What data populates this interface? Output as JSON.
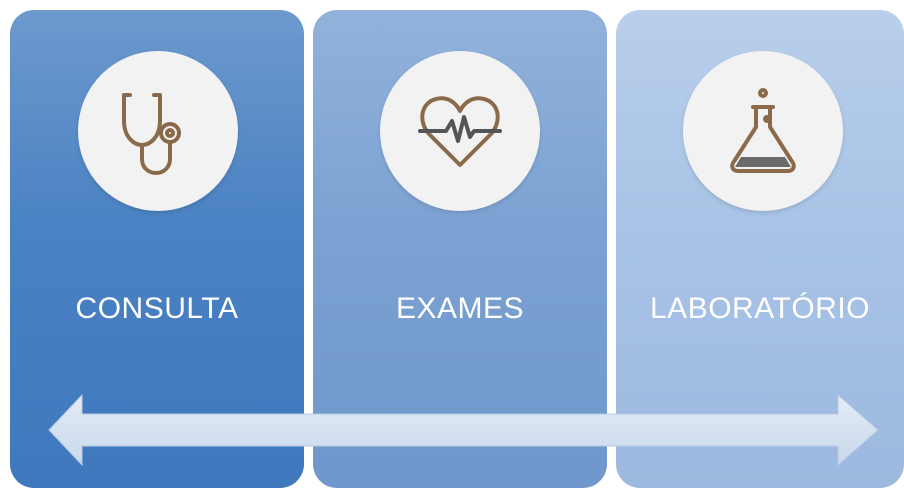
{
  "steps": [
    {
      "label": "CONSULTA",
      "icon": "stethoscope-icon"
    },
    {
      "label": "EXAMES",
      "icon": "heartbeat-icon"
    },
    {
      "label": "LABORATÓRIO",
      "icon": "flask-icon"
    }
  ],
  "colors": {
    "panel_1": "#4a82c3",
    "panel_2": "#7ca2d3",
    "panel_3": "#a8c3e6",
    "icon_circle": "#f2f2f2",
    "icon_stroke": "#8a6a4a",
    "arrow_fill": "#d6e2f1"
  }
}
